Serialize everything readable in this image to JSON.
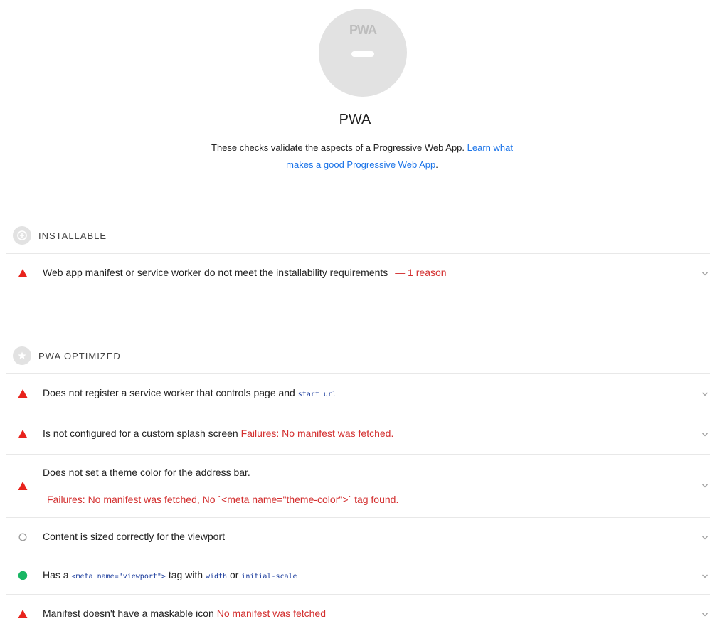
{
  "header": {
    "badge_text": "PWA",
    "title": "PWA",
    "description": "These checks validate the aspects of a Progressive Web App.",
    "learn_link_line1": "Learn what",
    "learn_link_line2": "makes a good Progressive Web App",
    "period": "."
  },
  "groups": {
    "installable": {
      "title": "INSTALLABLE",
      "icon": "plus-circle-icon"
    },
    "optimized": {
      "title": "PWA OPTIMIZED",
      "icon": "star-circle-icon"
    }
  },
  "audits": {
    "installability": {
      "status": "fail",
      "text": "Web app manifest or service worker do not meet the installability requirements",
      "reason": "— 1 reason"
    },
    "service_worker": {
      "status": "fail",
      "text": "Does not register a service worker that controls page and",
      "code": "start_url"
    },
    "splash": {
      "status": "fail",
      "text": "Is not configured for a custom splash screen",
      "failure": "Failures: No manifest was fetched."
    },
    "theme_color": {
      "status": "fail",
      "text": "Does not set a theme color for the address bar.",
      "failure": "Failures: No manifest was fetched, No `<meta name=\"theme-color\">` tag found."
    },
    "viewport_size": {
      "status": "manual",
      "text": "Content is sized correctly for the viewport"
    },
    "viewport_meta": {
      "status": "pass",
      "text_1": "Has a",
      "code_1": "<meta name=\"viewport\">",
      "text_2": "tag with",
      "code_2": "width",
      "text_3": "or",
      "code_3": "initial-scale"
    },
    "maskable": {
      "status": "fail",
      "text": "Manifest doesn't have a maskable icon",
      "failure": "No manifest was fetched"
    }
  },
  "colors": {
    "fail": "#d32f2f",
    "fail_icon": "#e8231c",
    "pass": "#18b663",
    "link": "#1a73e8",
    "code": "#1a3b9c"
  }
}
